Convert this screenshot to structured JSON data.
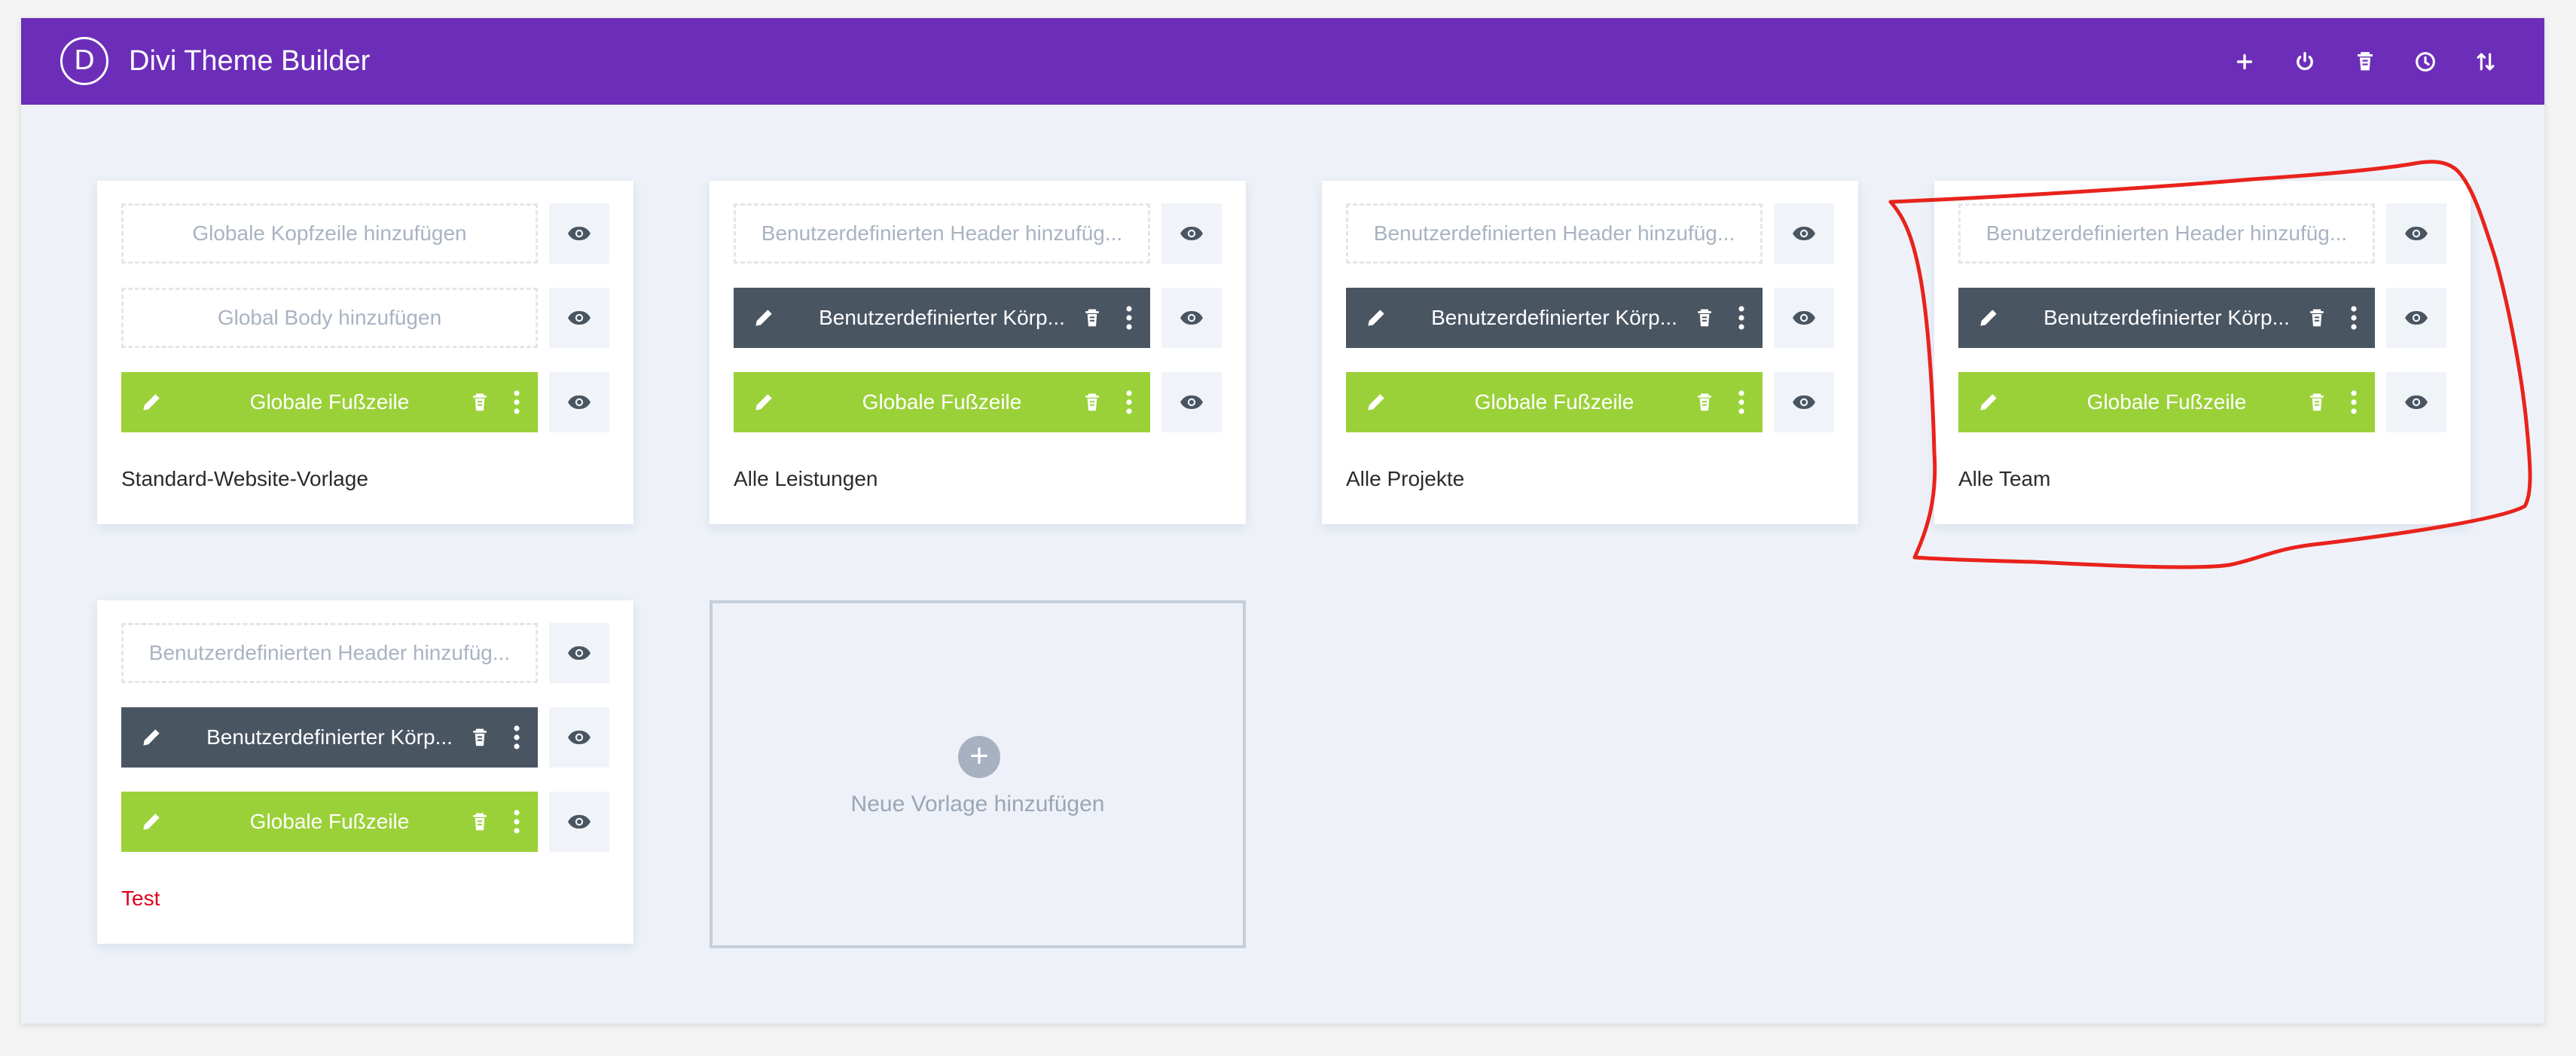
{
  "app": {
    "logo_letter": "D",
    "title": "Divi Theme Builder",
    "accent_color": "#6c2eb9",
    "top_actions": [
      "plus-icon",
      "power-icon",
      "trash-icon",
      "history-icon",
      "sort-icon"
    ]
  },
  "templates": [
    {
      "title": "Standard-Website-Vorlage",
      "header": {
        "state": "empty",
        "label": "Globale Kopfzeile hinzufügen"
      },
      "body": {
        "state": "empty",
        "label": "Global Body hinzufügen"
      },
      "footer": {
        "state": "filled",
        "label": "Globale Fußzeile",
        "color": "#9ad139"
      }
    },
    {
      "title": "Alle Leistungen",
      "header": {
        "state": "empty",
        "label": "Benutzerdefinierten Header hinzufüg..."
      },
      "body": {
        "state": "filled",
        "label": "Benutzerdefinierter Körp...",
        "color": "#4a5562"
      },
      "footer": {
        "state": "filled",
        "label": "Globale Fußzeile",
        "color": "#9ad139"
      }
    },
    {
      "title": "Alle Projekte",
      "header": {
        "state": "empty",
        "label": "Benutzerdefinierten Header hinzufüg..."
      },
      "body": {
        "state": "filled",
        "label": "Benutzerdefinierter Körp...",
        "color": "#4a5562"
      },
      "footer": {
        "state": "filled",
        "label": "Globale Fußzeile",
        "color": "#9ad139"
      }
    },
    {
      "title": "Alle Team",
      "header": {
        "state": "empty",
        "label": "Benutzerdefinierten Header hinzufüg..."
      },
      "body": {
        "state": "filled",
        "label": "Benutzerdefinierter Körp...",
        "color": "#4a5562"
      },
      "footer": {
        "state": "filled",
        "label": "Globale Fußzeile",
        "color": "#9ad139"
      }
    },
    {
      "title": "Test",
      "title_color": "#e0001b",
      "header": {
        "state": "empty",
        "label": "Benutzerdefinierten Header hinzufüg..."
      },
      "body": {
        "state": "filled",
        "label": "Benutzerdefinierter Körp...",
        "color": "#4a5562"
      },
      "footer": {
        "state": "filled",
        "label": "Globale Fußzeile",
        "color": "#9ad139"
      }
    }
  ],
  "new_template": {
    "label": "Neue Vorlage hinzufügen",
    "icon": "plus-icon"
  },
  "annotation": {
    "color": "#e8231c"
  }
}
